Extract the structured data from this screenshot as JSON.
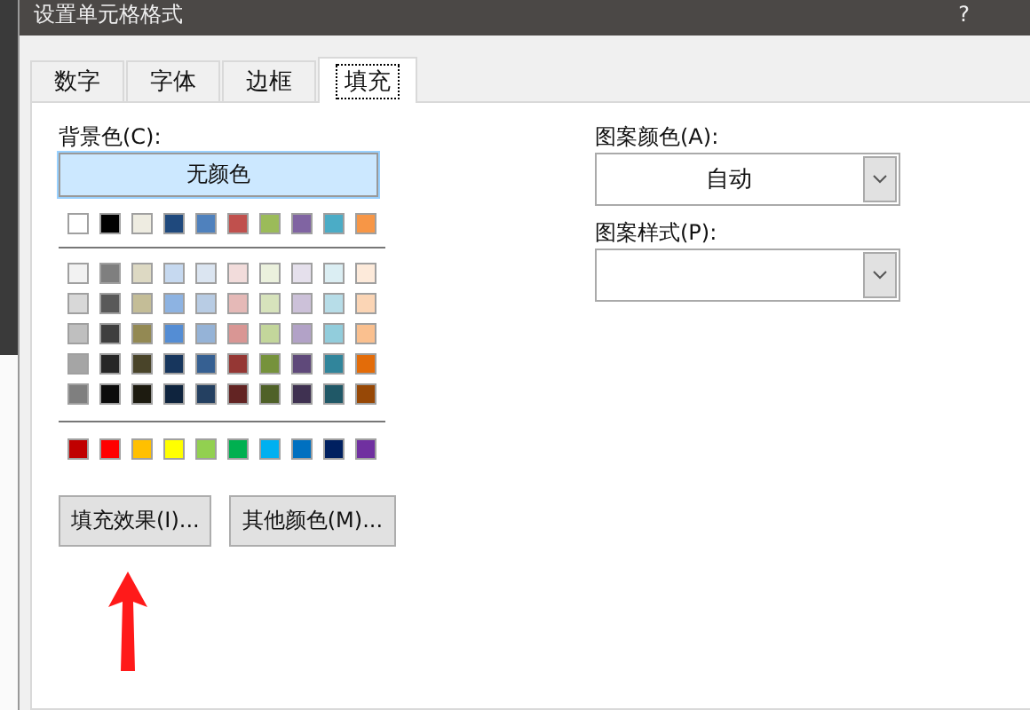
{
  "window": {
    "title": "设置单元格格式",
    "help": "?"
  },
  "tabs": [
    {
      "label": "数字",
      "selected": false
    },
    {
      "label": "字体",
      "selected": false
    },
    {
      "label": "边框",
      "selected": false
    },
    {
      "label": "填充",
      "selected": true
    }
  ],
  "background_color": {
    "label": "背景色(C):",
    "no_color_button": {
      "label": "无颜色",
      "selected": true
    },
    "theme_row": [
      {
        "color": "#ffffff",
        "selected": false
      },
      {
        "color": "#000000",
        "selected": false
      },
      {
        "color": "#eeece1",
        "selected": false
      },
      {
        "color": "#1f497d",
        "selected": false
      },
      {
        "color": "#4f81bd",
        "selected": false
      },
      {
        "color": "#c0504d",
        "selected": false
      },
      {
        "color": "#9bbb59",
        "selected": false
      },
      {
        "color": "#8064a2",
        "selected": false
      },
      {
        "color": "#4bacc6",
        "selected": false
      },
      {
        "color": "#f79646",
        "selected": false
      }
    ],
    "shade_rows": [
      [
        {
          "color": "#f2f2f2",
          "selected": false
        },
        {
          "color": "#7f7f7f",
          "selected": false
        },
        {
          "color": "#ddd9c3",
          "selected": false
        },
        {
          "color": "#c6d9f0",
          "selected": false
        },
        {
          "color": "#dbe5f1",
          "selected": false
        },
        {
          "color": "#f2dcdb",
          "selected": false
        },
        {
          "color": "#ebf1dd",
          "selected": false
        },
        {
          "color": "#e5e0ec",
          "selected": false
        },
        {
          "color": "#dbeef3",
          "selected": false
        },
        {
          "color": "#fdeada",
          "selected": false
        }
      ],
      [
        {
          "color": "#d8d8d8",
          "selected": false
        },
        {
          "color": "#595959",
          "selected": false
        },
        {
          "color": "#c4bd97",
          "selected": false
        },
        {
          "color": "#8db3e2",
          "selected": false
        },
        {
          "color": "#b8cce4",
          "selected": false
        },
        {
          "color": "#e5b9b7",
          "selected": false
        },
        {
          "color": "#d7e3bc",
          "selected": false
        },
        {
          "color": "#ccc1d9",
          "selected": false
        },
        {
          "color": "#b7dde8",
          "selected": false
        },
        {
          "color": "#fbd5b5",
          "selected": false
        }
      ],
      [
        {
          "color": "#bfbfbf",
          "selected": false
        },
        {
          "color": "#3f3f3f",
          "selected": false
        },
        {
          "color": "#938953",
          "selected": false
        },
        {
          "color": "#548dd4",
          "selected": false
        },
        {
          "color": "#95b3d7",
          "selected": false
        },
        {
          "color": "#d99694",
          "selected": false
        },
        {
          "color": "#c3d69b",
          "selected": false
        },
        {
          "color": "#b2a2c7",
          "selected": false
        },
        {
          "color": "#92cddc",
          "selected": false
        },
        {
          "color": "#fac08f",
          "selected": false
        }
      ],
      [
        {
          "color": "#a5a5a5",
          "selected": false
        },
        {
          "color": "#262626",
          "selected": false
        },
        {
          "color": "#494429",
          "selected": false
        },
        {
          "color": "#17365d",
          "selected": false
        },
        {
          "color": "#366092",
          "selected": false
        },
        {
          "color": "#953734",
          "selected": false
        },
        {
          "color": "#76923c",
          "selected": false
        },
        {
          "color": "#5f497a",
          "selected": false
        },
        {
          "color": "#31859b",
          "selected": false
        },
        {
          "color": "#e36c09",
          "selected": false
        }
      ],
      [
        {
          "color": "#7f7f7f",
          "selected": false
        },
        {
          "color": "#0c0c0c",
          "selected": false
        },
        {
          "color": "#1d1b10",
          "selected": false
        },
        {
          "color": "#0f243e",
          "selected": false
        },
        {
          "color": "#244061",
          "selected": false
        },
        {
          "color": "#632423",
          "selected": false
        },
        {
          "color": "#4f6128",
          "selected": false
        },
        {
          "color": "#3f3151",
          "selected": false
        },
        {
          "color": "#205867",
          "selected": false
        },
        {
          "color": "#974806",
          "selected": false
        }
      ]
    ],
    "standard_row": [
      {
        "color": "#c00000",
        "selected": false
      },
      {
        "color": "#ff0000",
        "selected": false
      },
      {
        "color": "#ffc000",
        "selected": false
      },
      {
        "color": "#ffff00",
        "selected": false
      },
      {
        "color": "#92d050",
        "selected": false
      },
      {
        "color": "#00b050",
        "selected": false
      },
      {
        "color": "#00b0f0",
        "selected": false
      },
      {
        "color": "#0070c0",
        "selected": false
      },
      {
        "color": "#002060",
        "selected": false
      },
      {
        "color": "#7030a0",
        "selected": false
      }
    ],
    "buttons": [
      "填充效果(I)...",
      "其他颜色(M)..."
    ]
  },
  "pattern_color": {
    "label": "图案颜色(A):",
    "value": "自动"
  },
  "pattern_style": {
    "label": "图案样式(P):"
  }
}
